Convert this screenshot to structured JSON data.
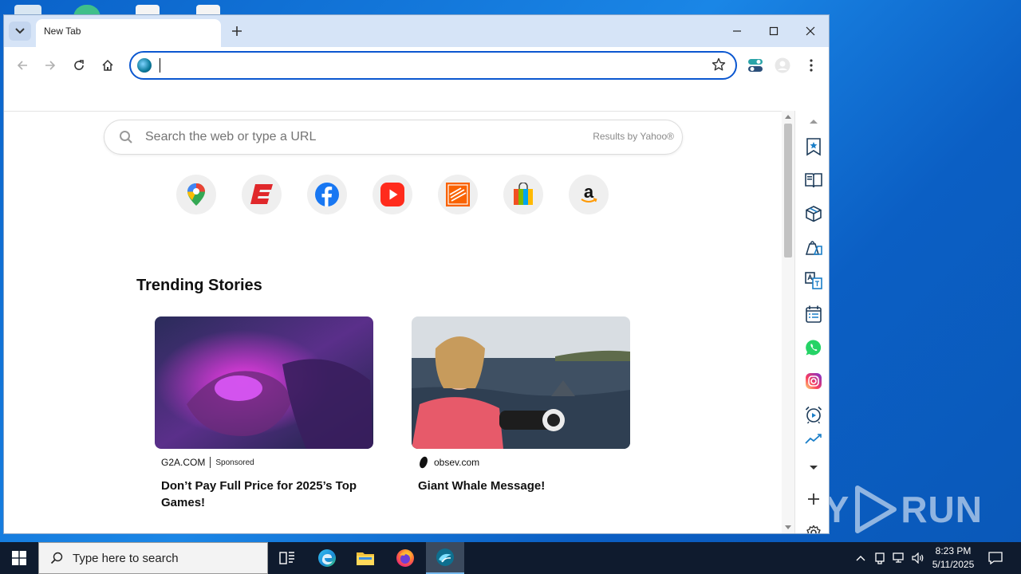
{
  "browser": {
    "tab_title": "New Tab",
    "omnibox_value": ""
  },
  "newtab": {
    "search_placeholder": "Search the web or type a URL",
    "search_provider": "Results by Yahoo®",
    "shortcuts": [
      "Google Maps",
      "ESPN",
      "Facebook",
      "YouTube",
      "The Home Depot",
      "Microsoft Store",
      "Amazon"
    ],
    "trending_title": "Trending Stories",
    "stories": [
      {
        "source": "G2A.COM",
        "sponsored": "Sponsored",
        "headline": "Don’t Pay Full Price for 2025’s Top Games!"
      },
      {
        "source": "obsev.com",
        "headline": "Giant Whale Message!"
      }
    ]
  },
  "sidebar": {
    "items": [
      "bookmark-star-icon",
      "reading-book-icon",
      "package-box-icon",
      "shopping-bags-icon",
      "translate-icon",
      "calendar-list-icon",
      "whatsapp-icon",
      "instagram-icon",
      "alarm-clock-icon",
      "chart-icon",
      "add-icon",
      "settings-icon"
    ]
  },
  "taskbar": {
    "search_placeholder": "Type here to search",
    "time": "8:23 PM",
    "date": "5/11/2025"
  },
  "watermark": {
    "left": "ANY",
    "right": "RUN"
  }
}
